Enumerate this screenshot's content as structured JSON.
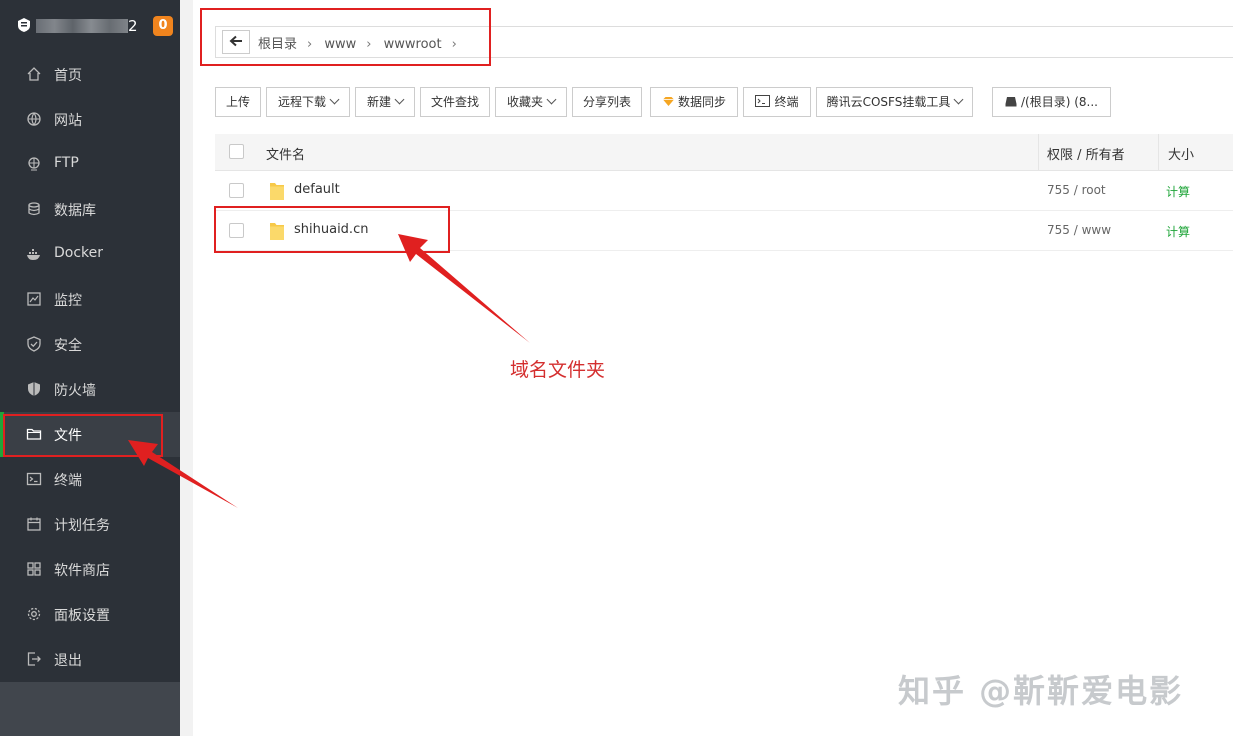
{
  "sidebar": {
    "server_name_suffix": "2",
    "badge_count": "0",
    "items": [
      {
        "label": "首页",
        "icon": "home-icon"
      },
      {
        "label": "网站",
        "icon": "globe-icon"
      },
      {
        "label": "FTP",
        "icon": "ftp-icon"
      },
      {
        "label": "数据库",
        "icon": "database-icon"
      },
      {
        "label": "Docker",
        "icon": "docker-icon"
      },
      {
        "label": "监控",
        "icon": "monitor-icon"
      },
      {
        "label": "安全",
        "icon": "shield-check-icon"
      },
      {
        "label": "防火墙",
        "icon": "firewall-shield-icon"
      },
      {
        "label": "文件",
        "icon": "folder-icon",
        "active": true
      },
      {
        "label": "终端",
        "icon": "terminal-icon"
      },
      {
        "label": "计划任务",
        "icon": "calendar-icon"
      },
      {
        "label": "软件商店",
        "icon": "apps-grid-icon"
      },
      {
        "label": "面板设置",
        "icon": "gear-icon"
      },
      {
        "label": "退出",
        "icon": "logout-icon"
      }
    ]
  },
  "breadcrumb": [
    "根目录",
    "www",
    "wwwroot"
  ],
  "toolbar": {
    "upload": "上传",
    "remote_download": "远程下载",
    "new": "新建",
    "file_search": "文件查找",
    "favorites": "收藏夹",
    "share_list": "分享列表",
    "data_sync": "数据同步",
    "terminal": "终端",
    "cosfs": "腾讯云COSFS挂载工具",
    "disk": "/(根目录) (8..."
  },
  "table": {
    "headers": {
      "name": "文件名",
      "perm": "权限 / 所有者",
      "size": "大小"
    },
    "rows": [
      {
        "name": "default",
        "perm": "755 / root",
        "size": "计算"
      },
      {
        "name": "shihuaid.cn",
        "perm": "755 / www",
        "size": "计算"
      }
    ]
  },
  "annotation": {
    "label": "域名文件夹"
  },
  "watermark": "知乎 @靳靳爱电影",
  "colors": {
    "sidebar_bg": "#2c3138",
    "accent_green": "#20a53a",
    "badge_orange": "#f0841e",
    "annotation_red": "#e02020"
  }
}
